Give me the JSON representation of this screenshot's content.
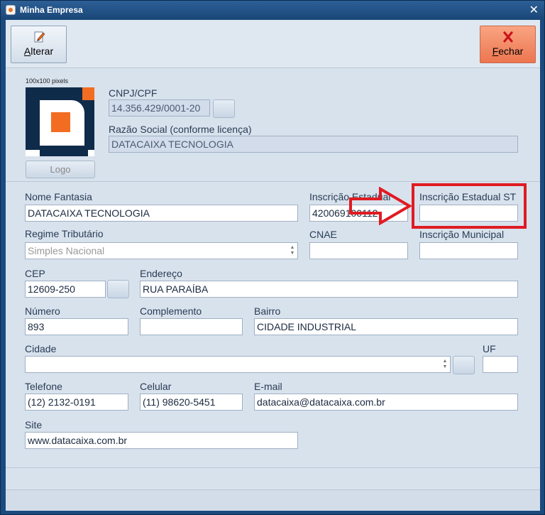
{
  "window": {
    "title": "Minha Empresa"
  },
  "toolbar": {
    "alterar_prefix": "A",
    "alterar_rest": "lterar",
    "fechar_prefix": "F",
    "fechar_rest": "echar"
  },
  "logo": {
    "hint": "100x100 pixels",
    "button_label": "Logo"
  },
  "company": {
    "cnpj_label": "CNPJ/CPF",
    "cnpj_value": "14.356.429/0001-20",
    "razao_label": "Razão Social (conforme licença)",
    "razao_value": "DATACAIXA TECNOLOGIA"
  },
  "form": {
    "nome_fantasia_label": "Nome Fantasia",
    "nome_fantasia_value": "DATACAIXA TECNOLOGIA",
    "inscricao_estadual_label": "Inscrição Estadual",
    "inscricao_estadual_value": "420069100112",
    "inscricao_estadual_st_label": "Inscrição Estadual ST",
    "inscricao_estadual_st_value": "",
    "regime_label": "Regime Tributário",
    "regime_value": "Simples Nacional",
    "cnae_label": "CNAE",
    "cnae_value": "",
    "inscricao_municipal_label": "Inscrição Municipal",
    "inscricao_municipal_value": "",
    "cep_label": "CEP",
    "cep_value": "12609-250",
    "endereco_label": "Endereço",
    "endereco_value": "RUA PARAÍBA",
    "numero_label": "Número",
    "numero_value": "893",
    "complemento_label": "Complemento",
    "complemento_value": "",
    "bairro_label": "Bairro",
    "bairro_value": "CIDADE INDUSTRIAL",
    "cidade_label": "Cidade",
    "cidade_value": "",
    "uf_label": "UF",
    "uf_value": "",
    "telefone_label": "Telefone",
    "telefone_value": "(12) 2132-0191",
    "celular_label": "Celular",
    "celular_value": "(11) 98620-5451",
    "email_label": "E-mail",
    "email_value": "datacaixa@datacaixa.com.br",
    "site_label": "Site",
    "site_value": "www.datacaixa.com.br"
  },
  "colors": {
    "accent_red": "#e01b22",
    "logo_orange": "#f26d21",
    "logo_navy": "#0f2b4a",
    "close_button": "#ef7d57"
  }
}
